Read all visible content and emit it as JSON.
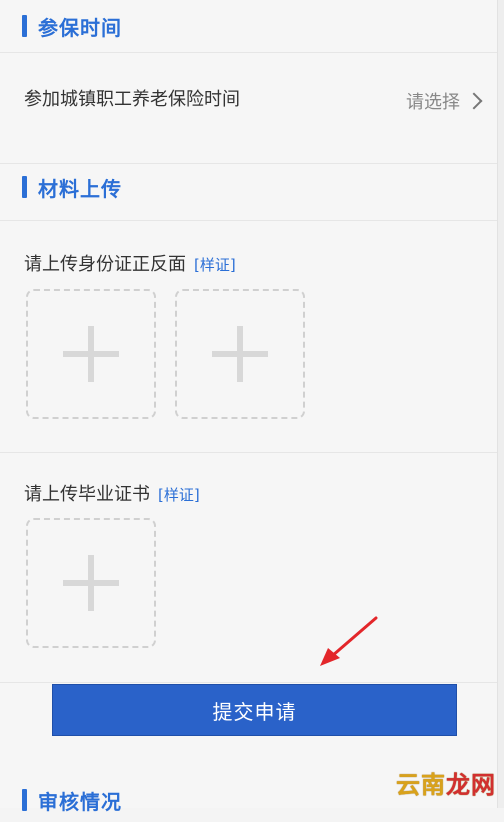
{
  "sections": {
    "insurance_time": {
      "title": "参保时间"
    },
    "materials": {
      "title": "材料上传"
    },
    "review": {
      "title": "审核情况"
    }
  },
  "insurance_time": {
    "label": "参加城镇职工养老保险时间",
    "placeholder": "请选择"
  },
  "uploads": {
    "id_card": {
      "label": "请上传身份证正反面",
      "sample": "[样证]"
    },
    "diploma": {
      "label": "请上传毕业证书",
      "sample": "[样证]"
    }
  },
  "actions": {
    "submit_label": "提交申请"
  },
  "watermark": {
    "text_left": "云南",
    "text_right": "龙网"
  },
  "colors": {
    "accent": "#2b6fd6",
    "button": "#2a62c9",
    "annotation_arrow": "#e3262a"
  }
}
